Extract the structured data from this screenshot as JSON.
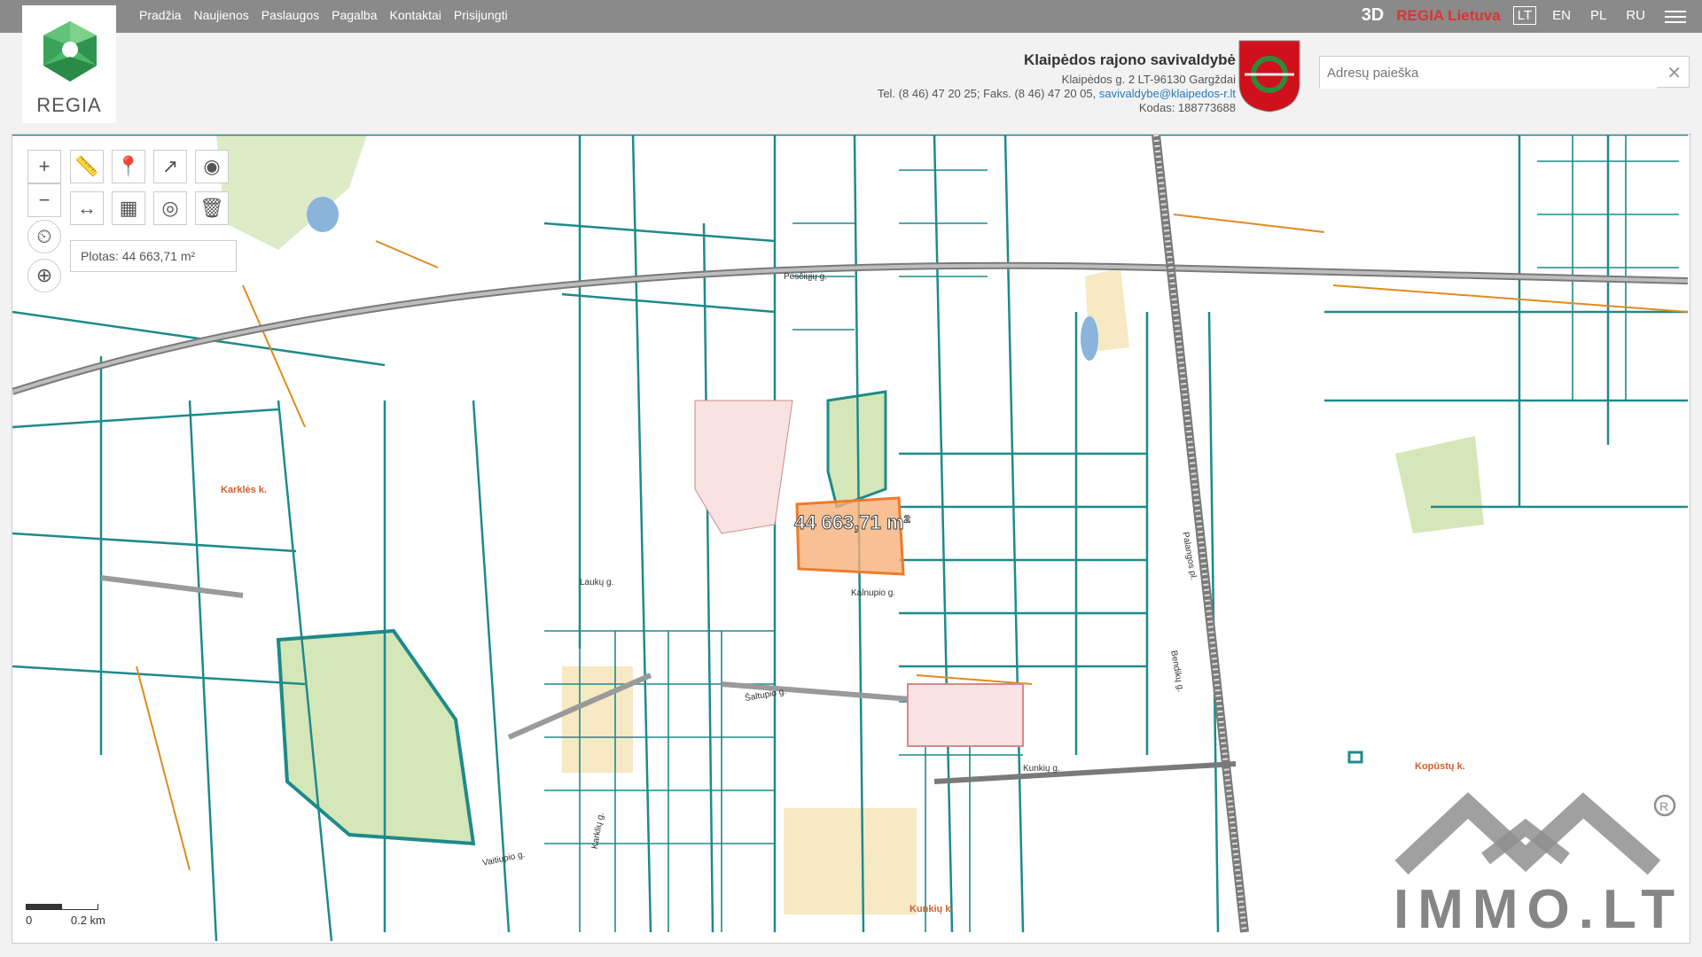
{
  "nav": [
    "Pradžia",
    "Naujienos",
    "Paslaugos",
    "Pagalba",
    "Kontaktai",
    "Prisijungti"
  ],
  "right": {
    "three_d": "3D",
    "regia": "REGIA Lietuva",
    "langs": [
      "LT",
      "EN",
      "PL",
      "RU"
    ],
    "active_lang": "LT"
  },
  "logo": {
    "text": "REGIA"
  },
  "municipality": {
    "name": "Klaipėdos rajono savivaldybė",
    "address": "Klaipėdos g. 2 LT-96130 Gargždai",
    "tel": "Tel. (8 46) 47 20 25; Faks. (8 46) 47 20 05,",
    "email": "savivaldybe@klaipedos-r.lt",
    "code": "Kodas: 188773688"
  },
  "search": {
    "placeholder": "Adresų paieška"
  },
  "map": {
    "area_label": "Plotas: 44 663,71 m²",
    "overlay_area": "44 663,71 m²",
    "scale": {
      "zero": "0",
      "dist": "0.2 km"
    },
    "places": [
      {
        "label": "Karklės k.",
        "color": "#d06030"
      },
      {
        "label": "Kopūstų k.",
        "color": "#d06030"
      },
      {
        "label": "Kunkių k.",
        "color": "#d06030"
      }
    ],
    "streets": [
      "Pėsčiųjų g.",
      "Palangos pl.",
      "Bendikų g.",
      "Kunkių g.",
      "Šaltupio g.",
      "Kalnupio g.",
      "Laukų g.",
      "Vaitiupio g.",
      "Karklių g."
    ],
    "watermark": "IMMO.LT"
  },
  "colors": {
    "parcel": "#1f8a8a",
    "selection": "#f5b07a",
    "green": "#d5e6b8",
    "topbar": "#8a8a8a"
  }
}
